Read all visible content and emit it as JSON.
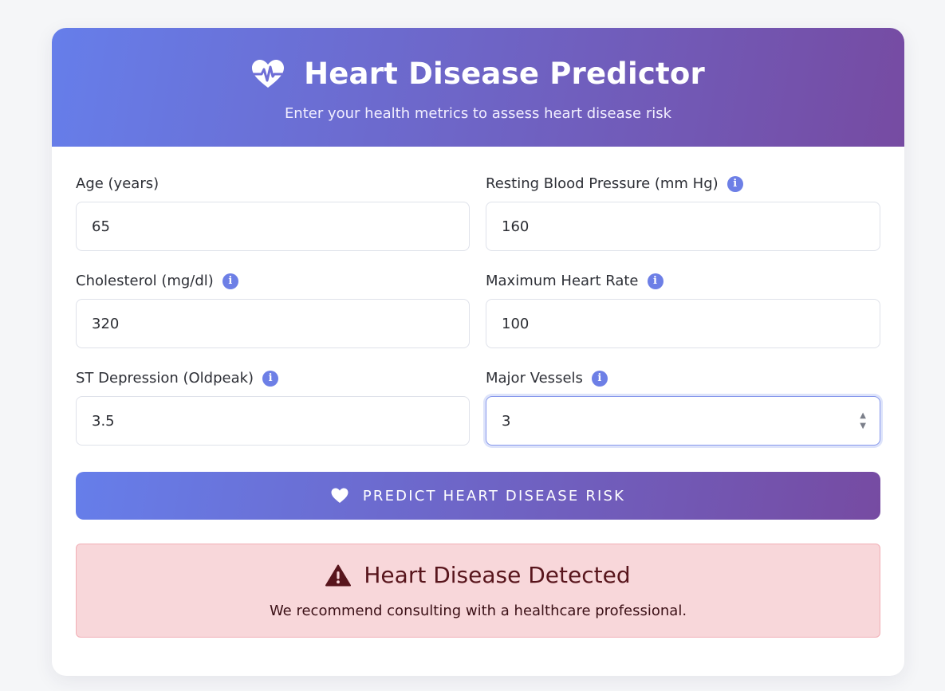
{
  "header": {
    "title": "Heart Disease Predictor",
    "subtitle": "Enter your health metrics to assess heart disease risk",
    "icon": "heart-pulse-icon"
  },
  "fields": [
    {
      "label": "Age (years)",
      "value": "65",
      "has_info": false
    },
    {
      "label": "Resting Blood Pressure (mm Hg)",
      "value": "160",
      "has_info": true
    },
    {
      "label": "Cholesterol (mg/dl)",
      "value": "320",
      "has_info": true
    },
    {
      "label": "Maximum Heart Rate",
      "value": "100",
      "has_info": true
    },
    {
      "label": "ST Depression (Oldpeak)",
      "value": "3.5",
      "has_info": true
    },
    {
      "label": "Major Vessels",
      "value": "3",
      "has_info": true,
      "focused": true,
      "control": "number-stepper"
    }
  ],
  "info_icon_glyph": "i",
  "predict_button": {
    "label": "PREDICT HEART DISEASE RISK",
    "icon": "heart-icon"
  },
  "result": {
    "title": "Heart Disease Detected",
    "message": "We recommend consulting with a healthcare professional.",
    "icon": "warning-icon"
  },
  "colors": {
    "gradient_start": "#667eea",
    "gradient_end": "#764ba2",
    "alert_background": "#f8d7da",
    "alert_text": "#58151c",
    "info_icon": "#6d7fe6"
  }
}
